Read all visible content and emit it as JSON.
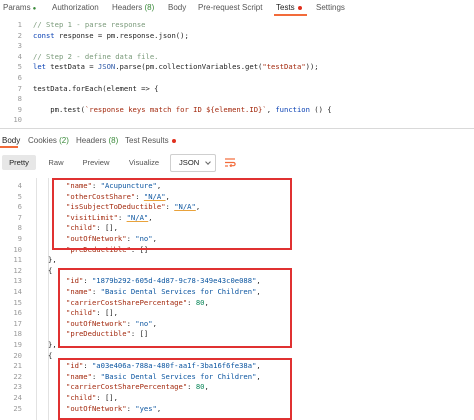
{
  "request_tabs": {
    "params": "Params",
    "params_dot": "●",
    "authorization": "Authorization",
    "headers": "Headers",
    "headers_count": "(8)",
    "body": "Body",
    "prerequest": "Pre-request Script",
    "tests": "Tests",
    "settings": "Settings"
  },
  "script": {
    "line_numbers": [
      "1",
      "2",
      "3",
      "4",
      "5",
      "6",
      "7",
      "8",
      "9",
      "10"
    ],
    "lines": [
      {
        "parts": [
          {
            "t": "// Step 1 - parse response",
            "c": "cm"
          }
        ]
      },
      {
        "parts": [
          {
            "t": "const",
            "c": "kw"
          },
          {
            "t": " response = pm.response.json();",
            "c": ""
          }
        ]
      },
      {
        "parts": []
      },
      {
        "parts": [
          {
            "t": "// Step 2 - define data file.",
            "c": "cm"
          }
        ]
      },
      {
        "parts": [
          {
            "t": "let",
            "c": "kw"
          },
          {
            "t": " testData = ",
            "c": ""
          },
          {
            "t": "JSON",
            "c": "fn"
          },
          {
            "t": ".parse(pm.collectionVariables.get(",
            "c": ""
          },
          {
            "t": "\"testData\"",
            "c": "str"
          },
          {
            "t": "));",
            "c": ""
          }
        ]
      },
      {
        "parts": []
      },
      {
        "parts": [
          {
            "t": "testData.forEach(element => {",
            "c": ""
          }
        ]
      },
      {
        "parts": []
      },
      {
        "parts": [
          {
            "t": "    pm.test(",
            "c": ""
          },
          {
            "t": "`response keys match for ID ${element.ID}`",
            "c": "str"
          },
          {
            "t": ", ",
            "c": ""
          },
          {
            "t": "function",
            "c": "kw"
          },
          {
            "t": " () {",
            "c": ""
          }
        ]
      },
      {
        "parts": []
      }
    ]
  },
  "response_tabs": {
    "body": "Body",
    "cookies": "Cookies",
    "cookies_count": "(2)",
    "headers": "Headers",
    "headers_count": "(8)",
    "test_results": "Test Results"
  },
  "toolbar": {
    "pretty": "Pretty",
    "raw": "Raw",
    "preview": "Preview",
    "visualize": "Visualize",
    "format_selected": "JSON"
  },
  "response": {
    "line_numbers": [
      "4",
      "5",
      "6",
      "7",
      "8",
      "9",
      "10",
      "11",
      "12",
      "13",
      "14",
      "15",
      "16",
      "17",
      "18",
      "19",
      "20",
      "21",
      "22",
      "23",
      "24",
      "25"
    ],
    "lines": [
      {
        "indent": 66,
        "parts": [
          {
            "t": "\"name\"",
            "c": "key"
          },
          {
            "t": ": ",
            "c": ""
          },
          {
            "t": "\"Acupuncture\"",
            "c": "sval"
          },
          {
            "t": ",",
            "c": ""
          }
        ]
      },
      {
        "indent": 66,
        "parts": [
          {
            "t": "\"otherCostShare\"",
            "c": "key"
          },
          {
            "t": ": ",
            "c": ""
          },
          {
            "t": "\"N/A\"",
            "c": "sval ulink"
          },
          {
            "t": ",",
            "c": ""
          }
        ]
      },
      {
        "indent": 66,
        "parts": [
          {
            "t": "\"isSubjectToDeductible\"",
            "c": "key"
          },
          {
            "t": ": ",
            "c": ""
          },
          {
            "t": "\"N/A\"",
            "c": "sval ulink"
          },
          {
            "t": ",",
            "c": ""
          }
        ]
      },
      {
        "indent": 66,
        "parts": [
          {
            "t": "\"visitLimit\"",
            "c": "key"
          },
          {
            "t": ": ",
            "c": ""
          },
          {
            "t": "\"N/A\"",
            "c": "sval ulink"
          },
          {
            "t": ",",
            "c": ""
          }
        ]
      },
      {
        "indent": 66,
        "parts": [
          {
            "t": "\"child\"",
            "c": "key"
          },
          {
            "t": ": [],",
            "c": ""
          }
        ]
      },
      {
        "indent": 66,
        "parts": [
          {
            "t": "\"outOfNetwork\"",
            "c": "key"
          },
          {
            "t": ": ",
            "c": ""
          },
          {
            "t": "\"no\"",
            "c": "sval"
          },
          {
            "t": ",",
            "c": ""
          }
        ]
      },
      {
        "indent": 66,
        "parts": [
          {
            "t": "\"preDeductible\"",
            "c": "key"
          },
          {
            "t": ": []",
            "c": ""
          }
        ]
      },
      {
        "indent": 48,
        "parts": [
          {
            "t": "},",
            "c": ""
          }
        ]
      },
      {
        "indent": 48,
        "parts": [
          {
            "t": "{",
            "c": ""
          }
        ]
      },
      {
        "indent": 66,
        "parts": [
          {
            "t": "\"id\"",
            "c": "key"
          },
          {
            "t": ": ",
            "c": ""
          },
          {
            "t": "\"1879b292-605d-4d87-9c78-349e43c0e088\"",
            "c": "sval"
          },
          {
            "t": ",",
            "c": ""
          }
        ]
      },
      {
        "indent": 66,
        "parts": [
          {
            "t": "\"name\"",
            "c": "key"
          },
          {
            "t": ": ",
            "c": ""
          },
          {
            "t": "\"Basic Dental Services for Children\"",
            "c": "sval"
          },
          {
            "t": ",",
            "c": ""
          }
        ]
      },
      {
        "indent": 66,
        "parts": [
          {
            "t": "\"carrierCostSharePercentage\"",
            "c": "key"
          },
          {
            "t": ": ",
            "c": ""
          },
          {
            "t": "80",
            "c": "nval"
          },
          {
            "t": ",",
            "c": ""
          }
        ]
      },
      {
        "indent": 66,
        "parts": [
          {
            "t": "\"child\"",
            "c": "key"
          },
          {
            "t": ": [],",
            "c": ""
          }
        ]
      },
      {
        "indent": 66,
        "parts": [
          {
            "t": "\"outOfNetwork\"",
            "c": "key"
          },
          {
            "t": ": ",
            "c": ""
          },
          {
            "t": "\"no\"",
            "c": "sval"
          },
          {
            "t": ",",
            "c": ""
          }
        ]
      },
      {
        "indent": 66,
        "parts": [
          {
            "t": "\"preDeductible\"",
            "c": "key"
          },
          {
            "t": ": []",
            "c": ""
          }
        ]
      },
      {
        "indent": 48,
        "parts": [
          {
            "t": "},",
            "c": ""
          }
        ]
      },
      {
        "indent": 48,
        "parts": [
          {
            "t": "{",
            "c": ""
          }
        ]
      },
      {
        "indent": 66,
        "parts": [
          {
            "t": "\"id\"",
            "c": "key"
          },
          {
            "t": ": ",
            "c": ""
          },
          {
            "t": "\"a03e406a-788a-480f-aa1f-3ba16f6fe38a\"",
            "c": "sval"
          },
          {
            "t": ",",
            "c": ""
          }
        ]
      },
      {
        "indent": 66,
        "parts": [
          {
            "t": "\"name\"",
            "c": "key"
          },
          {
            "t": ": ",
            "c": ""
          },
          {
            "t": "\"Basic Dental Services for Children\"",
            "c": "sval"
          },
          {
            "t": ",",
            "c": ""
          }
        ]
      },
      {
        "indent": 66,
        "parts": [
          {
            "t": "\"carrierCostSharePercentage\"",
            "c": "key"
          },
          {
            "t": ": ",
            "c": ""
          },
          {
            "t": "80",
            "c": "nval"
          },
          {
            "t": ",",
            "c": ""
          }
        ]
      },
      {
        "indent": 66,
        "parts": [
          {
            "t": "\"child\"",
            "c": "key"
          },
          {
            "t": ": [],",
            "c": ""
          }
        ]
      },
      {
        "indent": 66,
        "parts": [
          {
            "t": "\"outOfNetwork\"",
            "c": "key"
          },
          {
            "t": ": ",
            "c": ""
          },
          {
            "t": "\"yes\"",
            "c": "sval"
          },
          {
            "t": ",",
            "c": ""
          }
        ]
      }
    ]
  },
  "colors": {
    "accent": "#f26b3a",
    "highlight_box": "#e03131",
    "status_dot": "#e0301e",
    "count_green": "#3a8a3a"
  },
  "icons": {
    "format_select": "chevron-down-icon",
    "wrap": "wrap-lines-icon"
  }
}
